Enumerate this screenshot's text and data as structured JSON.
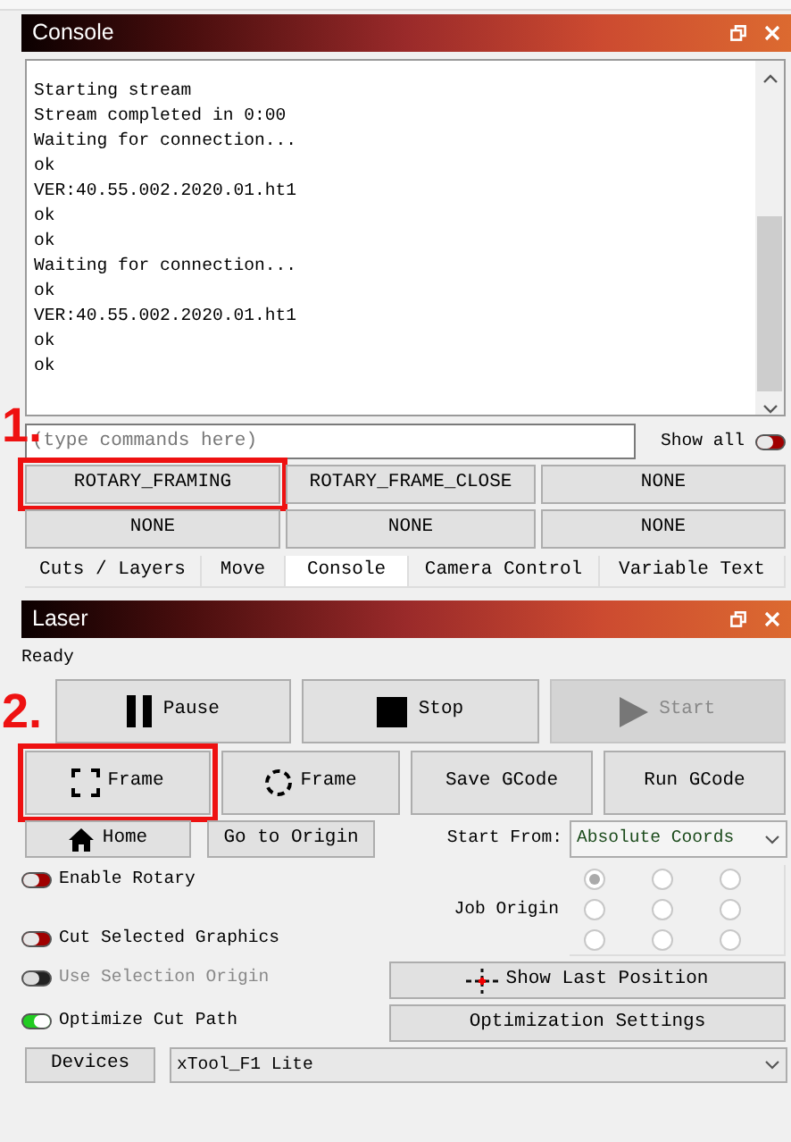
{
  "console": {
    "title": "Console",
    "lines": [
      "Starting stream",
      "Stream completed in 0:00",
      "Waiting for connection...",
      "ok",
      "VER:40.55.002.2020.01.ht1",
      "ok",
      "ok",
      "Waiting for connection...",
      "ok",
      "VER:40.55.002.2020.01.ht1",
      "ok",
      "ok"
    ],
    "input": {
      "placeholder": "(type commands here)"
    },
    "show_all": {
      "label": "Show all",
      "on": false
    },
    "macro_buttons": [
      {
        "label": "ROTARY_FRAMING",
        "highlighted": true,
        "annotation": "1."
      },
      {
        "label": "ROTARY_FRAME_CLOSE",
        "highlighted": false
      },
      {
        "label": "NONE",
        "highlighted": false
      },
      {
        "label": "NONE",
        "highlighted": false
      },
      {
        "label": "NONE",
        "highlighted": false
      },
      {
        "label": "NONE",
        "highlighted": false
      }
    ]
  },
  "tabs": [
    {
      "label": "Cuts / Layers",
      "selected": false
    },
    {
      "label": "Move",
      "selected": false
    },
    {
      "label": "Console",
      "selected": true
    },
    {
      "label": "Camera Control",
      "selected": false
    },
    {
      "label": "Variable Text",
      "selected": false
    }
  ],
  "laser": {
    "title": "Laser",
    "status": "Ready",
    "job_buttons": [
      {
        "label": "Pause",
        "kind": "pause",
        "disabled": false
      },
      {
        "label": "Stop",
        "kind": "stop",
        "disabled": false
      },
      {
        "label": "Start",
        "kind": "play",
        "disabled": true
      }
    ],
    "frame_buttons": [
      {
        "label": "Frame",
        "kind": "square",
        "highlighted": true,
        "annotation": "2."
      },
      {
        "label": "Frame",
        "kind": "circle",
        "highlighted": false
      },
      {
        "label": "Save GCode",
        "highlighted": false
      },
      {
        "label": "Run GCode",
        "highlighted": false
      }
    ],
    "home_button": {
      "label": "Home"
    },
    "origin_button": {
      "label": "Go to Origin"
    },
    "start_from": {
      "label": "Start From:",
      "value": "Absolute Coords"
    },
    "toggles": [
      {
        "label": "Enable Rotary",
        "on": false,
        "disabled": false
      },
      {
        "label": "Cut Selected Graphics",
        "on": false,
        "disabled": false
      },
      {
        "label": "Use Selection Origin",
        "on": false,
        "disabled": true
      },
      {
        "label": "Optimize Cut Path",
        "on": true,
        "disabled": false
      }
    ],
    "job_origin": {
      "label": "Job Origin",
      "points": [
        {
          "selected": true
        },
        {
          "selected": false
        },
        {
          "selected": false
        },
        {
          "selected": false
        },
        {
          "selected": false
        },
        {
          "selected": false
        },
        {
          "selected": false
        },
        {
          "selected": false
        },
        {
          "selected": false
        }
      ]
    },
    "show_last_position": {
      "label": "Show Last Position"
    },
    "optimization_settings": {
      "label": "Optimization Settings"
    },
    "devices_button": {
      "label": "Devices"
    },
    "device": {
      "value": "xTool_F1 Lite"
    }
  }
}
